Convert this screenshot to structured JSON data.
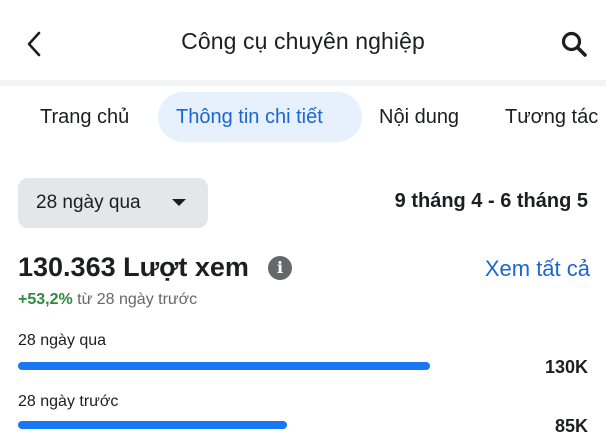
{
  "header": {
    "title": "Công cụ chuyên nghiệp",
    "back_icon": "chevron-left-icon",
    "search_icon": "search-icon"
  },
  "tabs": [
    {
      "label": "Trang chủ",
      "active": false
    },
    {
      "label": "Thông tin chi tiết",
      "active": true
    },
    {
      "label": "Nội dung",
      "active": false
    },
    {
      "label": "Tương tác",
      "active": false
    }
  ],
  "filter": {
    "range_label": "28 ngày qua",
    "date_range": "9 tháng 4 - 6 tháng 5"
  },
  "stats": {
    "total_views": "130.363 Lượt xem",
    "info_icon": "i",
    "see_all": "Xem tất cả",
    "change_pct": "+53,2%",
    "change_text": " từ 28 ngày trước"
  },
  "comparison": [
    {
      "label": "28 ngày qua",
      "value_label": "130K",
      "value": 130
    },
    {
      "label": "28 ngày trước",
      "value_label": "85K",
      "value": 85
    }
  ],
  "colors": {
    "accent": "#1a67d2",
    "bar": "#1877f2",
    "positive": "#2e8a3e"
  }
}
